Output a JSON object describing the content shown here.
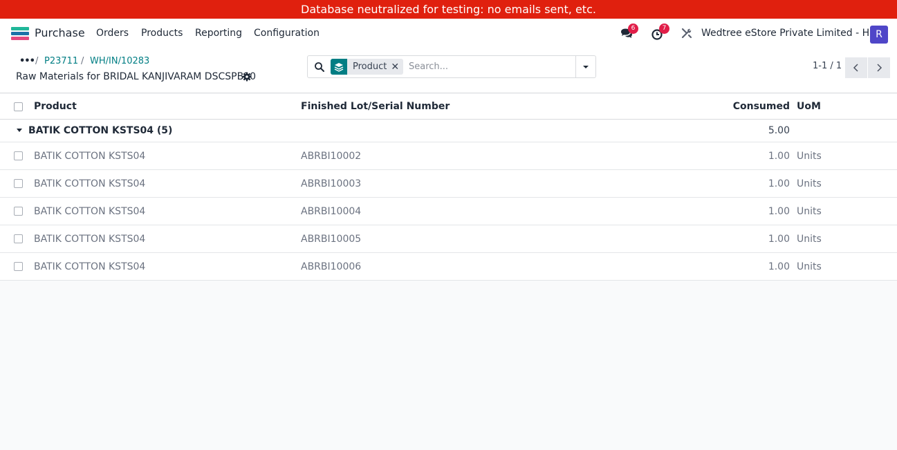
{
  "banner": {
    "text": "Database neutralized for testing: no emails sent, etc."
  },
  "navbar": {
    "app_name": "Purchase",
    "menu": [
      "Orders",
      "Products",
      "Reporting",
      "Configuration"
    ],
    "messages_badge": "6",
    "activities_badge": "7",
    "company": "Wedtree eStore Private Limited - HO",
    "avatar_letter": "R",
    "logo_colors": [
      "#21b799",
      "#1a73a8",
      "#e14a7f"
    ]
  },
  "breadcrumb": {
    "items": [
      "P23711",
      "WH/IN/10283"
    ],
    "title": "Raw Materials for BRIDAL KANJIVARAM DSCSPB10"
  },
  "search": {
    "facet_label": "Product",
    "placeholder": "Search..."
  },
  "pager": {
    "value": "1-1 / 1"
  },
  "table": {
    "columns": {
      "product": "Product",
      "lot": "Finished Lot/Serial Number",
      "consumed": "Consumed",
      "uom": "UoM"
    },
    "group": {
      "label": "BATIK COTTON KSTS04 (5)",
      "total": "5.00"
    },
    "rows": [
      {
        "product": "BATIK COTTON KSTS04",
        "lot": "ABRBI10002",
        "consumed": "1.00",
        "uom": "Units"
      },
      {
        "product": "BATIK COTTON KSTS04",
        "lot": "ABRBI10003",
        "consumed": "1.00",
        "uom": "Units"
      },
      {
        "product": "BATIK COTTON KSTS04",
        "lot": "ABRBI10004",
        "consumed": "1.00",
        "uom": "Units"
      },
      {
        "product": "BATIK COTTON KSTS04",
        "lot": "ABRBI10005",
        "consumed": "1.00",
        "uom": "Units"
      },
      {
        "product": "BATIK COTTON KSTS04",
        "lot": "ABRBI10006",
        "consumed": "1.00",
        "uom": "Units"
      }
    ]
  }
}
